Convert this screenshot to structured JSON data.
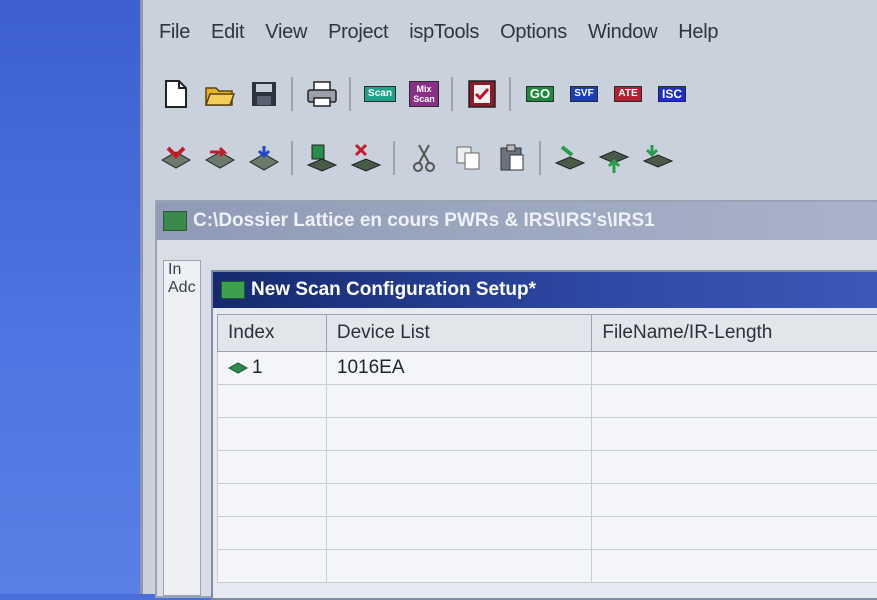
{
  "menubar": {
    "items": [
      "File",
      "Edit",
      "View",
      "Project",
      "ispTools",
      "Options",
      "Window",
      "Help"
    ]
  },
  "toolbar1": {
    "buttons": [
      {
        "icon": "new-file-icon"
      },
      {
        "icon": "open-folder-icon"
      },
      {
        "icon": "save-icon"
      },
      {
        "icon": "print-icon"
      },
      {
        "icon": "scan-icon",
        "label": "Scan"
      },
      {
        "icon": "mix-scan-icon",
        "label": "Mix\nScan"
      },
      {
        "icon": "check-icon"
      },
      {
        "icon": "go-icon",
        "label": "GO"
      },
      {
        "icon": "svf-icon",
        "label": "SVF"
      },
      {
        "icon": "ate-icon",
        "label": "ATE"
      },
      {
        "icon": "isc-icon",
        "label": "ISC"
      }
    ]
  },
  "toolbar2": {
    "buttons": [
      {
        "icon": "device-red-icon"
      },
      {
        "icon": "device-red-arrow-icon"
      },
      {
        "icon": "device-blue-icon"
      },
      {
        "icon": "device-add-icon"
      },
      {
        "icon": "device-remove-icon"
      },
      {
        "icon": "cut-icon"
      },
      {
        "icon": "copy-icon"
      },
      {
        "icon": "paste-icon"
      },
      {
        "icon": "move-icon"
      },
      {
        "icon": "move-up-icon"
      },
      {
        "icon": "move-down-icon"
      }
    ]
  },
  "mdi": {
    "title": "C:\\Dossier Lattice en cours PWRs & IRS\\IRS's\\IRS1",
    "left_header": "In",
    "left_row": "Adc"
  },
  "child": {
    "title": "New Scan Configuration Setup*",
    "columns": [
      "Index",
      "Device List",
      "FileName/IR-Length"
    ],
    "rows": [
      {
        "index": "1",
        "device": "1016EA",
        "filename": ""
      },
      {
        "index": "",
        "device": "",
        "filename": ""
      },
      {
        "index": "",
        "device": "",
        "filename": ""
      },
      {
        "index": "",
        "device": "",
        "filename": ""
      },
      {
        "index": "",
        "device": "",
        "filename": ""
      },
      {
        "index": "",
        "device": "",
        "filename": ""
      },
      {
        "index": "",
        "device": "",
        "filename": ""
      }
    ]
  }
}
